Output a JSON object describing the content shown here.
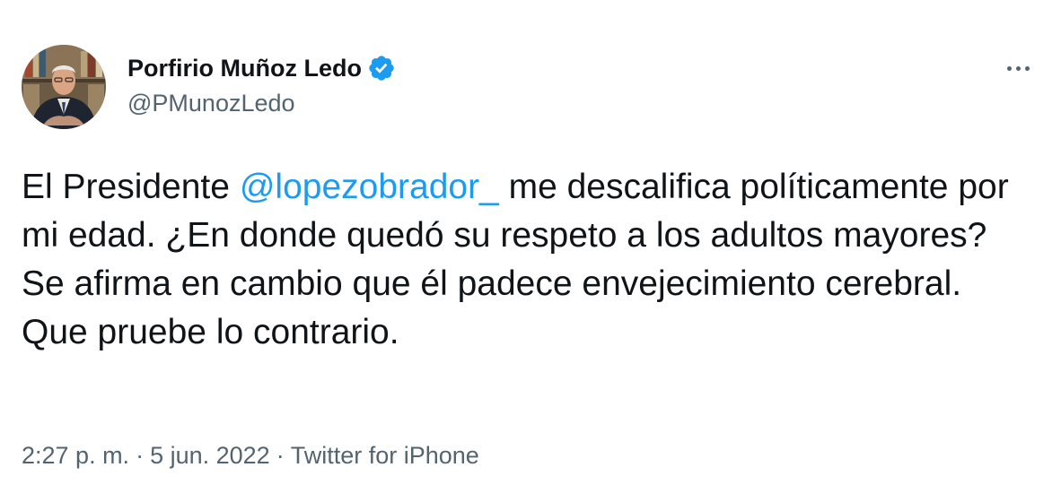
{
  "author": {
    "display_name": "Porfirio Muñoz Ledo",
    "handle": "@PMunozLedo",
    "verified": true
  },
  "menu": {
    "icon": "more-horizontal-icon"
  },
  "tweet": {
    "text_before": "El Presidente ",
    "mention": "@lopezobrador_",
    "text_after": " me descalifica políticamente por mi edad. ¿En donde quedó su respeto a los adultos mayores? Se afirma en cambio que él padece envejecimiento cerebral. Que pruebe lo contrario."
  },
  "meta": {
    "time": "2:27 p. m.",
    "separator": "·",
    "date": "5 jun. 2022",
    "source": "Twitter for iPhone"
  },
  "colors": {
    "accent": "#1d9bf0",
    "text": "#0f1419",
    "secondary": "#536471"
  }
}
